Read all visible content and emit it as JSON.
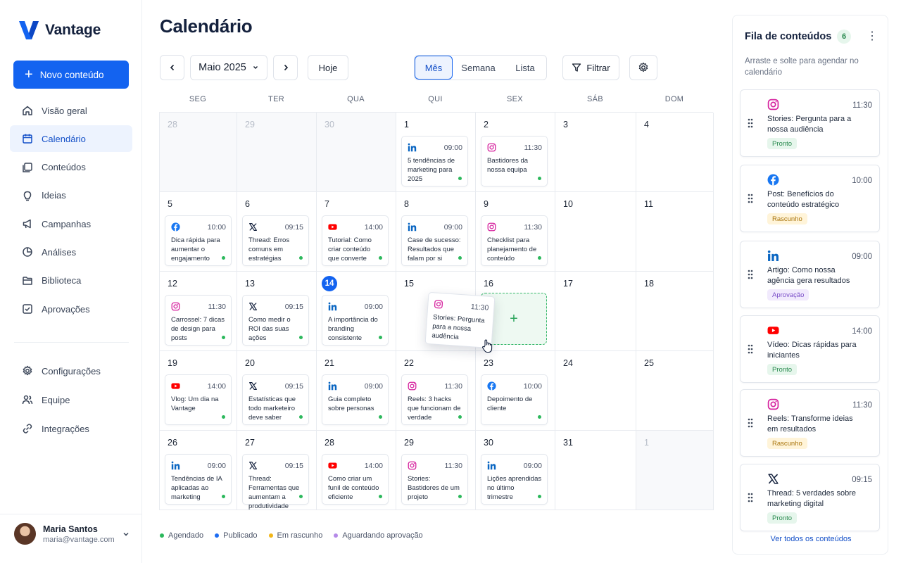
{
  "app": {
    "name": "Vantage",
    "brand_color": "#1363f0"
  },
  "sidebar": {
    "new_button": "Novo conteúdo",
    "items": [
      {
        "label": "Visão geral",
        "icon": "home-icon"
      },
      {
        "label": "Calendário",
        "icon": "calendar-icon",
        "active": true
      },
      {
        "label": "Conteúdos",
        "icon": "content-icon"
      },
      {
        "label": "Ideias",
        "icon": "lightbulb-icon"
      },
      {
        "label": "Campanhas",
        "icon": "megaphone-icon"
      },
      {
        "label": "Análises",
        "icon": "chart-pie-icon"
      },
      {
        "label": "Biblioteca",
        "icon": "folder-icon"
      },
      {
        "label": "Aprovações",
        "icon": "check-square-icon"
      }
    ],
    "items2": [
      {
        "label": "Configurações",
        "icon": "gear-icon"
      },
      {
        "label": "Equipe",
        "icon": "users-icon"
      },
      {
        "label": "Integrações",
        "icon": "link-icon"
      }
    ],
    "user": {
      "name": "Maria Santos",
      "email": "maria@vantage.com"
    }
  },
  "header": {
    "title": "Calendário",
    "month": "Maio 2025",
    "today": "Hoje",
    "views": [
      "Mês",
      "Semana",
      "Lista"
    ],
    "active_view": "Mês",
    "filter": "Filtrar"
  },
  "calendar": {
    "weekdays": [
      "SEG",
      "TER",
      "QUA",
      "QUI",
      "SEX",
      "SÁB",
      "DOM"
    ],
    "today": "14",
    "weeks": [
      [
        {
          "day": "28",
          "out": true
        },
        {
          "day": "29",
          "out": true
        },
        {
          "day": "30",
          "out": true
        },
        {
          "day": "1",
          "post": {
            "net": "linkedin",
            "time": "09:00",
            "text": "5 tendências de marketing para 2025"
          }
        },
        {
          "day": "2",
          "post": {
            "net": "instagram",
            "time": "11:30",
            "text": "Bastidores da nossa equipa"
          }
        },
        {
          "day": "3"
        },
        {
          "day": "4"
        }
      ],
      [
        {
          "day": "5",
          "post": {
            "net": "facebook",
            "time": "10:00",
            "text": "Dica rápida para aumentar o engajamento"
          }
        },
        {
          "day": "6",
          "post": {
            "net": "x",
            "time": "09:15",
            "text": "Thread: Erros comuns em estratégias"
          }
        },
        {
          "day": "7",
          "post": {
            "net": "youtube",
            "time": "14:00",
            "text": "Tutorial: Como criar conteúdo que converte"
          }
        },
        {
          "day": "8",
          "post": {
            "net": "linkedin",
            "time": "09:00",
            "text": "Case de sucesso: Resultados que falam por si"
          }
        },
        {
          "day": "9",
          "post": {
            "net": "instagram",
            "time": "11:30",
            "text": "Checklist para planejamento de conteúdo"
          }
        },
        {
          "day": "10"
        },
        {
          "day": "11"
        }
      ],
      [
        {
          "day": "12",
          "post": {
            "net": "instagram",
            "time": "11:30",
            "text": "Carrossel: 7 dicas de design para posts"
          }
        },
        {
          "day": "13",
          "post": {
            "net": "x",
            "time": "09:15",
            "text": "Como medir o ROI das suas ações"
          }
        },
        {
          "day": "14",
          "post": {
            "net": "linkedin",
            "time": "09:00",
            "text": "A importância do branding consistente"
          }
        },
        {
          "day": "15"
        },
        {
          "day": "16"
        },
        {
          "day": "17"
        },
        {
          "day": "18"
        }
      ],
      [
        {
          "day": "19",
          "post": {
            "net": "youtube",
            "time": "14:00",
            "text": "Vlog: Um dia na Vantage"
          }
        },
        {
          "day": "20",
          "post": {
            "net": "x",
            "time": "09:15",
            "text": "Estatísticas que todo marketeiro deve saber"
          }
        },
        {
          "day": "21",
          "post": {
            "net": "linkedin",
            "time": "09:00",
            "text": "Guia completo sobre personas"
          }
        },
        {
          "day": "22",
          "post": {
            "net": "instagram",
            "time": "11:30",
            "text": "Reels: 3 hacks que funcionam de verdade"
          }
        },
        {
          "day": "23",
          "post": {
            "net": "facebook",
            "time": "10:00",
            "text": "Depoimento de cliente"
          }
        },
        {
          "day": "24"
        },
        {
          "day": "25"
        }
      ],
      [
        {
          "day": "26",
          "post": {
            "net": "linkedin",
            "time": "09:00",
            "text": "Tendências de IA aplicadas ao marketing"
          }
        },
        {
          "day": "27",
          "post": {
            "net": "x",
            "time": "09:15",
            "text": "Thread: Ferramentas que aumentam a produtividade"
          }
        },
        {
          "day": "28",
          "post": {
            "net": "youtube",
            "time": "14:00",
            "text": "Como criar um funil de conteúdo eficiente"
          }
        },
        {
          "day": "29",
          "post": {
            "net": "instagram",
            "time": "11:30",
            "text": "Stories: Bastidores de um projeto"
          }
        },
        {
          "day": "30",
          "post": {
            "net": "linkedin",
            "time": "09:00",
            "text": "Lições aprendidas no último trimestre"
          }
        },
        {
          "day": "31"
        },
        {
          "day": "1",
          "out": true
        }
      ]
    ],
    "drag_card": {
      "net": "instagram",
      "time": "11:30",
      "text": "Stories: Pergunta para a nossa audência"
    },
    "drop_symbol": "+"
  },
  "legend": [
    {
      "label": "Agendado",
      "color": "#2cb85c"
    },
    {
      "label": "Publicado",
      "color": "#1d6cf2"
    },
    {
      "label": "Em rascunho",
      "color": "#f2b619"
    },
    {
      "label": "Aguardando aprovação",
      "color": "#b58ae8"
    }
  ],
  "queue": {
    "title": "Fila de conteúdos",
    "count": "6",
    "subtitle": "Arraste e solte para agendar no calendário",
    "items": [
      {
        "net": "instagram",
        "time": "11:30",
        "text": "Stories: Pergunta para a nossa audiência",
        "status": "Pronto",
        "kind": "pronto"
      },
      {
        "net": "facebook",
        "time": "10:00",
        "text": "Post: Benefícios do conteúdo estratégico",
        "status": "Rascunho",
        "kind": "rascunho"
      },
      {
        "net": "linkedin",
        "time": "09:00",
        "text": "Artigo: Como nossa agência gera resultados",
        "status": "Aprovação",
        "kind": "aprov"
      },
      {
        "net": "youtube",
        "time": "14:00",
        "text": "Vídeo: Dicas rápidas para iniciantes",
        "status": "Pronto",
        "kind": "pronto"
      },
      {
        "net": "instagram",
        "time": "11:30",
        "text": "Reels: Transforme ideias em resultados",
        "status": "Rascunho",
        "kind": "rascunho"
      },
      {
        "net": "x",
        "time": "09:15",
        "text": "Thread: 5 verdades sobre marketing digital",
        "status": "Pronto",
        "kind": "pronto"
      }
    ],
    "view_all": "Ver todos os conteúdos"
  }
}
